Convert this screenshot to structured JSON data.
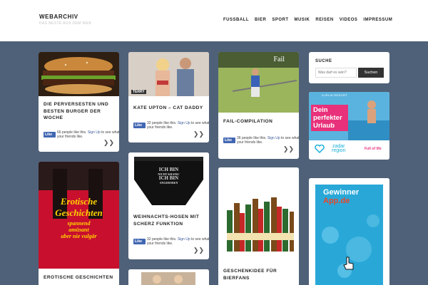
{
  "site": {
    "title": "WEBARCHIV",
    "tagline": "DAS BESTE AUS DEM WEB"
  },
  "nav": [
    "FUSSBALL",
    "BIER",
    "SPORT",
    "MUSIK",
    "REISEN",
    "VIDEOS",
    "IMPRESSUM"
  ],
  "search": {
    "title": "SUCHE",
    "placeholder": "Was darf es sein?",
    "button": "Suchen"
  },
  "fb": {
    "badge": "Like",
    "suffix": " people like this. ",
    "signup": "Sign Up",
    "tail": " to see what your friends like."
  },
  "cards": [
    {
      "title": "DIE PERVERSESTEN UND BESTEN BURGER DER WOCHE",
      "likes": "66"
    },
    {
      "title": "KATE UPTON – CAT DADDY",
      "likes": "32",
      "watermark": "TERRY"
    },
    {
      "title": "FAIL-COMPILATION",
      "likes": "36",
      "image_text": "Fail"
    },
    {
      "title": "EROTISCHE GESCHICHTEN",
      "image_lines": [
        "Erotische",
        "Geschichten",
        "spannend",
        "amüsant",
        "aber nie vulgär"
      ]
    },
    {
      "title": "WEIHNACHTS-HOSEN MIT SCHERZ FUNKTION",
      "likes": "32",
      "image_lines": [
        "ICH BIN",
        "NICHT KRANK!",
        "ICH BIN",
        "ANGEBOREN"
      ]
    },
    {
      "title": "GESCHENKIDEE FÜR BIERFANS"
    }
  ],
  "ads": {
    "ad1": {
      "brand": "ILIRIJA RESORT",
      "lines": [
        "Dein",
        "perfekter",
        "Urlaub"
      ],
      "region_top": "zadar",
      "region_bottom": "region",
      "logo": "Full of life"
    },
    "ad2": {
      "lines": [
        "Gewinner",
        "App.de"
      ]
    }
  },
  "colors": {
    "page_bg": "#4f6178",
    "fb_blue": "#4267b2",
    "ad_pink": "#e8317a",
    "ad_teal": "#1ab0d8"
  }
}
